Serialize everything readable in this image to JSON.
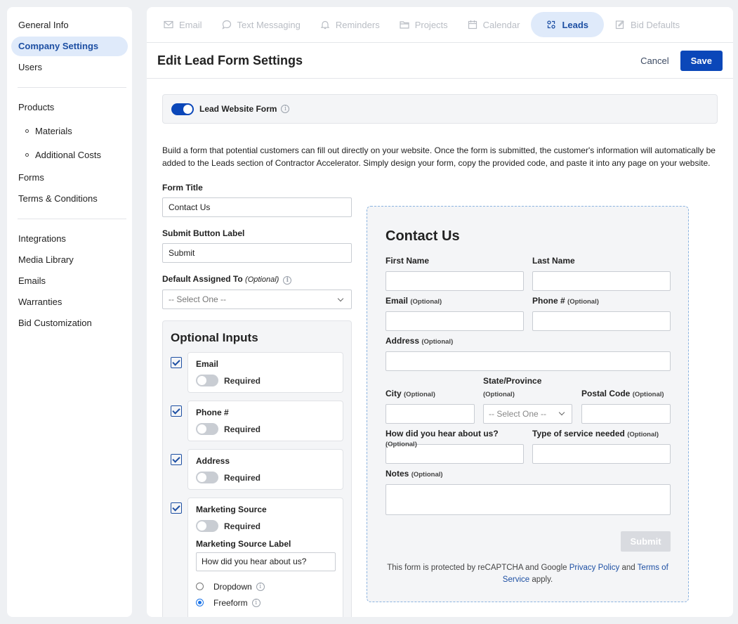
{
  "sidebar": {
    "group1": [
      "General Info",
      "Company Settings",
      "Users"
    ],
    "products": "Products",
    "materials": "Materials",
    "additional_costs": "Additional Costs",
    "forms": "Forms",
    "terms": "Terms & Conditions",
    "group3": [
      "Integrations",
      "Media Library",
      "Emails",
      "Warranties",
      "Bid Customization"
    ],
    "active": "Company Settings"
  },
  "tabs": [
    {
      "label": "Email",
      "icon": "mail-icon"
    },
    {
      "label": "Text Messaging",
      "icon": "chat-icon"
    },
    {
      "label": "Reminders",
      "icon": "bell-icon"
    },
    {
      "label": "Projects",
      "icon": "folder-icon"
    },
    {
      "label": "Calendar",
      "icon": "calendar-icon"
    },
    {
      "label": "Leads",
      "icon": "leads-icon"
    },
    {
      "label": "Bid Defaults",
      "icon": "edit-icon"
    }
  ],
  "header": {
    "title": "Edit Lead Form Settings",
    "cancel": "Cancel",
    "save": "Save"
  },
  "toggle": {
    "label": "Lead Website Form",
    "on": true
  },
  "description": "Build a form that potential customers can fill out directly on your website. Once the form is submitted, the customer's information will automatically be added to the Leads section of Contractor Accelerator. Simply design your form, copy the provided code, and paste it into any page on your website.",
  "form": {
    "title_label": "Form Title",
    "title_value": "Contact Us",
    "submit_label": "Submit Button Label",
    "submit_value": "Submit",
    "assigned_label": "Default Assigned To",
    "assigned_optional": "(Optional)",
    "assigned_value": "-- Select One --"
  },
  "optional_inputs": {
    "title": "Optional Inputs",
    "required_label": "Required",
    "items": [
      "Email",
      "Phone #",
      "Address",
      "Marketing Source"
    ],
    "ms_label": "Marketing Source Label",
    "ms_value": "How did you hear about us?",
    "radio_dropdown": "Dropdown",
    "radio_freeform": "Freeform",
    "selected_radio": "Freeform"
  },
  "preview": {
    "title": "Contact Us",
    "optional": "(Optional)",
    "first_name": "First Name",
    "last_name": "Last Name",
    "email": "Email",
    "phone": "Phone #",
    "address": "Address",
    "city": "City",
    "state": "State/Province",
    "state_value": "-- Select One --",
    "postal": "Postal Code",
    "hear": "How did you hear about us?",
    "service": "Type of service needed",
    "notes": "Notes",
    "submit": "Submit",
    "note_prefix": "This form is protected by reCAPTCHA and Google ",
    "privacy": "Privacy Policy",
    "and": " and ",
    "terms": "Terms of Service",
    "note_suffix": " apply."
  },
  "colors": {
    "accent": "#0b47b9",
    "active_bg": "#dfeafa",
    "page_bg": "#eef0f3"
  }
}
